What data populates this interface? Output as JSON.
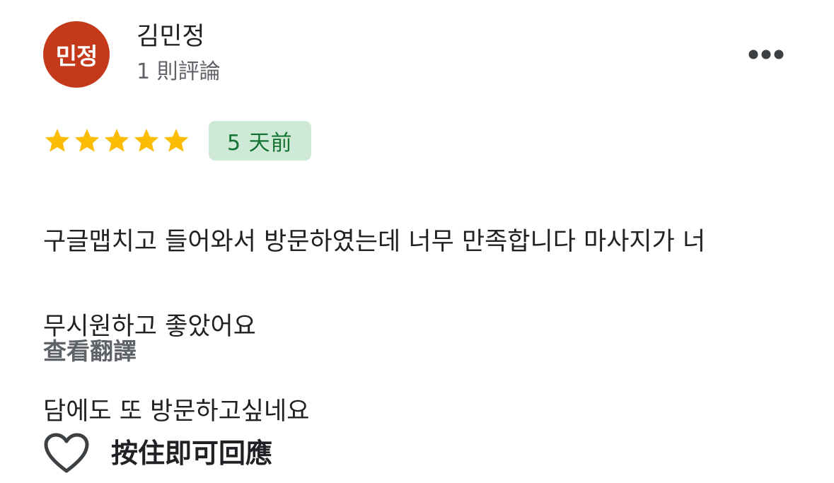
{
  "reviewer": {
    "avatar_text": "민정",
    "avatar_color": "#c5391b",
    "name": "김민정",
    "review_count": "1 則評論"
  },
  "menu": {
    "icon": "more-horizontal-icon"
  },
  "rating": {
    "stars": 5,
    "max_stars": 5,
    "star_color": "#fbbc04",
    "icon": "star-icon"
  },
  "date_badge": {
    "text": "5 天前",
    "background": "#ceead6",
    "text_color": "#137333"
  },
  "review": {
    "lines": [
      "구글맵치고 들어와서 방문하였는데 너무 만족합니다 마사지가 너",
      "무시원하고 좋았어요",
      "담에도 또 방문하고싶네요"
    ]
  },
  "translate_label": "查看翻譯",
  "reply": {
    "icon": "heart-outline-icon",
    "label": "按住即可回應"
  }
}
